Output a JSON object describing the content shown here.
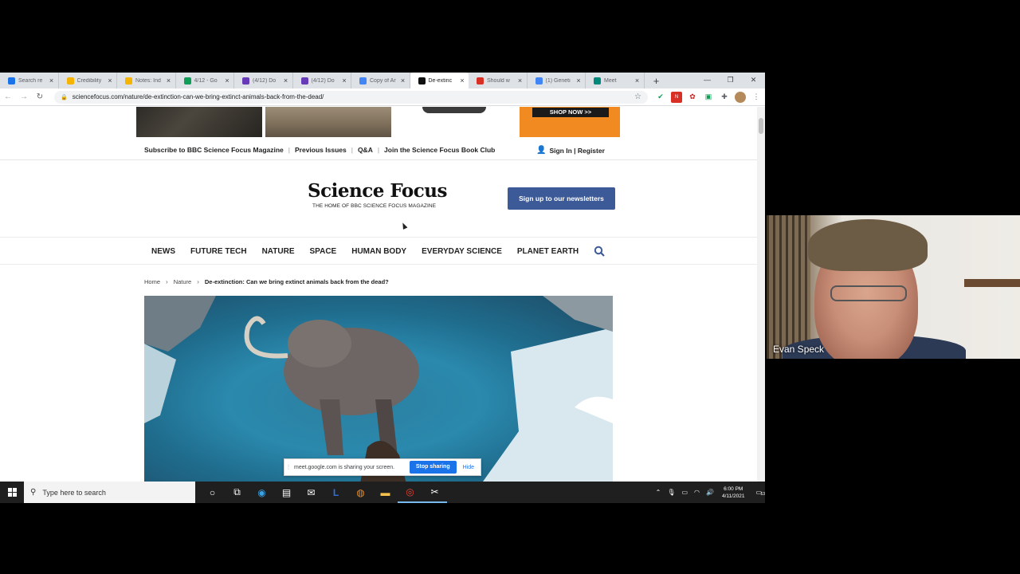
{
  "browser": {
    "tabs": [
      {
        "title": "Search re",
        "icon": "google-drive-icon",
        "color": "#1a73e8"
      },
      {
        "title": "Credibility",
        "icon": "google-slides-icon",
        "color": "#f4b400"
      },
      {
        "title": "Notes: Ind",
        "icon": "google-slides-icon",
        "color": "#f4b400"
      },
      {
        "title": "4/12 - Go",
        "icon": "google-drive-icon",
        "color": "#0f9d58"
      },
      {
        "title": "(4/12) Do",
        "icon": "google-forms-icon",
        "color": "#673ab7"
      },
      {
        "title": "(4/12) Do",
        "icon": "google-forms-icon",
        "color": "#673ab7"
      },
      {
        "title": "Copy of Ar",
        "icon": "google-docs-icon",
        "color": "#4285f4"
      },
      {
        "title": "De-extinc",
        "icon": "sf-icon",
        "color": "#111111",
        "active": true
      },
      {
        "title": "Should w",
        "icon": "s-icon",
        "color": "#d93025"
      },
      {
        "title": "(1) Geneti",
        "icon": "google-docs-icon",
        "color": "#4285f4"
      },
      {
        "title": "Meet",
        "icon": "google-meet-icon",
        "color": "#00897b"
      }
    ],
    "new_tab": "+",
    "url": "sciencefocus.com/nature/de-extinction-can-we-bring-extinct-animals-back-from-the-dead/"
  },
  "site": {
    "shop_now": "SHOP NOW >>",
    "top_links": [
      "Subscribe to BBC Science Focus Magazine",
      "Previous Issues",
      "Q&A",
      "Join the Science Focus Book Club"
    ],
    "sign_in": "Sign In | Register",
    "logo": "Science Focus",
    "tagline": "THE HOME OF BBC SCIENCE FOCUS MAGAZINE",
    "newsletter_btn": "Sign up to our newsletters",
    "nav": [
      "NEWS",
      "FUTURE TECH",
      "NATURE",
      "SPACE",
      "HUMAN BODY",
      "EVERYDAY SCIENCE",
      "PLANET EARTH"
    ],
    "breadcrumb": [
      "Home",
      "Nature",
      "De-extinction: Can we bring extinct animals back from the dead?"
    ]
  },
  "meet_bar": {
    "message": "meet.google.com is sharing your screen.",
    "stop": "Stop sharing",
    "hide": "Hide"
  },
  "taskbar": {
    "search_placeholder": "Type here to search",
    "time": "6:00 PM",
    "date": "4/11/2021",
    "notifications": "13"
  },
  "participant": {
    "name": "Evan Speck"
  }
}
